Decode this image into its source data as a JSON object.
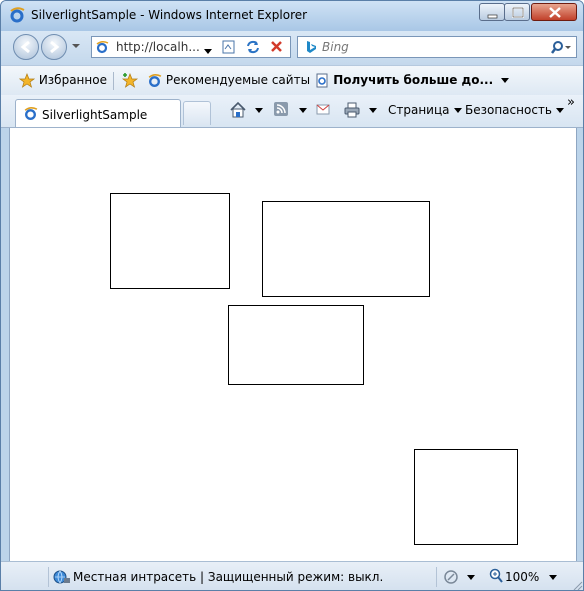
{
  "window": {
    "title": "SilverlightSample - Windows Internet Explorer"
  },
  "navigation": {
    "address": "http://localh...",
    "search_placeholder": "Bing"
  },
  "favorites_bar": {
    "favorites_label": "Избранное",
    "suggested_sites_label": "Рекомендуемые сайты",
    "get_more_label": "Получить больше до..."
  },
  "tabs": [
    {
      "label": "SilverlightSample"
    }
  ],
  "command_bar": {
    "page_label": "Страница",
    "safety_label": "Безопасность",
    "overflow_label": "»"
  },
  "status_bar": {
    "zone_text": "Местная интрасеть | Защищенный режим: выкл.",
    "zoom_text": "100%"
  },
  "colors": {
    "accent": "#3a6ea5",
    "close_button": "#c1402a",
    "content_background": "#ffffff"
  }
}
